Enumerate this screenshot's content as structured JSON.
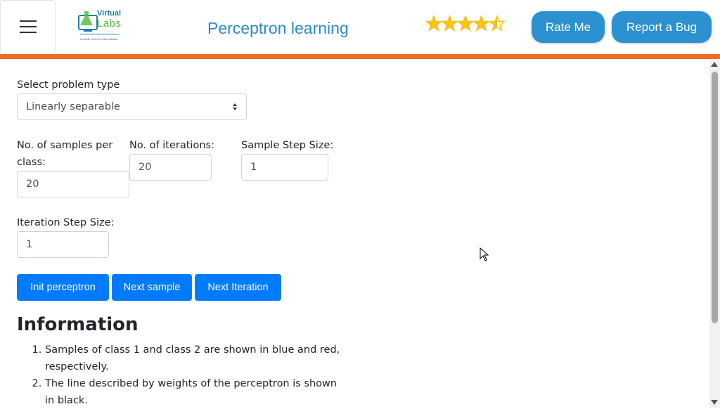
{
  "header": {
    "menu_icon": "hamburger-menu-icon",
    "logo": {
      "line1": "Virtual",
      "line2": "Labs",
      "tagline": "An MoE Govt of India Initiative"
    },
    "title": "Perceptron learning",
    "rating": {
      "value": 4.5,
      "max": 5,
      "color": "#f6c21c"
    },
    "rate_label": "Rate Me",
    "bug_label": "Report a Bug",
    "accent_color": "#f26b24",
    "button_color": "#2b91d0"
  },
  "form": {
    "problem_type": {
      "label": "Select problem type",
      "value": "Linearly separable"
    },
    "samples": {
      "label": "No. of samples per class:",
      "value": "20"
    },
    "iterations": {
      "label": "No. of iterations:",
      "value": "20"
    },
    "sample_step": {
      "label": "Sample Step Size:",
      "value": "1"
    },
    "iteration_step": {
      "label": "Iteration Step Size:",
      "value": "1"
    }
  },
  "buttons": {
    "init": "Init perceptron",
    "next_sample": "Next sample",
    "next_iteration": "Next Iteration",
    "color": "#007bff"
  },
  "info": {
    "heading": "Information",
    "items": [
      "Samples of class 1 and class 2 are shown in blue and red, respectively.",
      "The line described by weights of the perceptron is shown in black."
    ]
  }
}
